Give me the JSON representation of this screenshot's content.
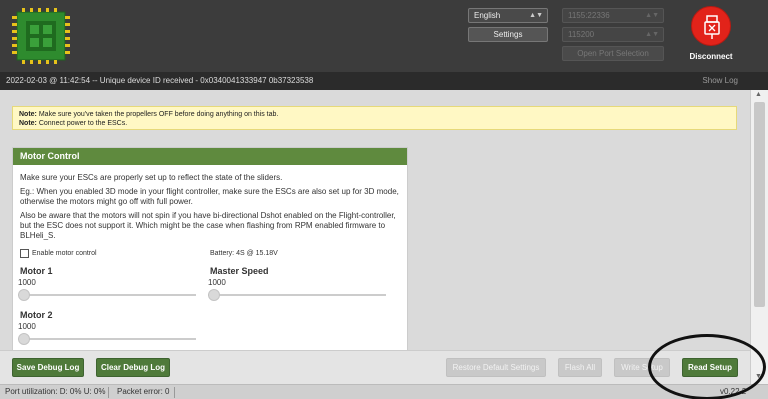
{
  "header": {
    "language": "English",
    "settings_label": "Settings",
    "port": "1155:22336",
    "baud": "115200",
    "open_port_label": "Open Port Selection",
    "disconnect_label": "Disconnect"
  },
  "log": {
    "message": "2022-02-03 @ 11:42:54 -- Unique device ID received - 0x0340041333947 0b37323538",
    "show_log_label": "Show Log"
  },
  "notes": {
    "line1_prefix": "Note:",
    "line1_text": "Make sure you've taken the propellers OFF before doing anything on this tab.",
    "line2_prefix": "Note:",
    "line2_text": "Connect power to the ESCs."
  },
  "motor_control": {
    "title": "Motor Control",
    "intro": "Make sure your ESCs are properly set up to reflect the state of the sliders.",
    "example": "Eg.: When you enabled 3D mode in your flight controller, make sure the ESCs are also set up for 3D mode, otherwise the motors might go off with full power.",
    "warning": "Also be aware that the motors will not spin if you have bi-directional Dshot enabled on the Flight-controller, but the ESC does not support it. Which might be the case when flashing from RPM enabled firmware to BLHeli_S.",
    "enable_label": "Enable motor control",
    "enabled": false,
    "battery": "Battery: 4S @ 15.18V",
    "motors": [
      {
        "label": "Motor 1",
        "value": "1000"
      },
      {
        "label": "Master Speed",
        "value": "1000"
      },
      {
        "label": "Motor 2",
        "value": "1000"
      }
    ]
  },
  "toolbar": {
    "save_debug_log": "Save Debug Log",
    "clear_debug_log": "Clear Debug Log",
    "restore_defaults": "Restore Default Settings",
    "flash_all": "Flash All",
    "write_setup": "Write Setup",
    "read_setup": "Read Setup"
  },
  "status": {
    "port_utilization": "Port utilization: D: 0% U: 0%",
    "packet_error": "Packet error: 0",
    "version": "v0.22.2"
  },
  "colors": {
    "accent_green": "#5f8a3e",
    "button_green": "#4f7a3a",
    "disconnect_red": "#e2231a",
    "note_yellow": "#fff8c4"
  }
}
